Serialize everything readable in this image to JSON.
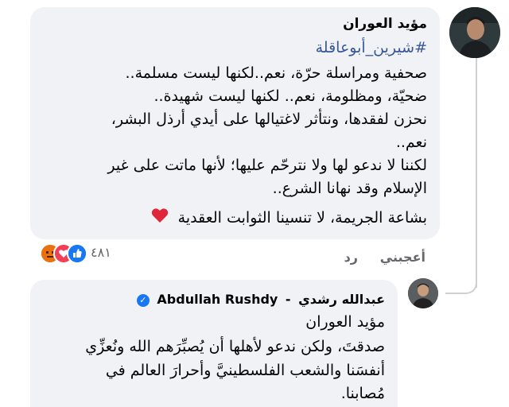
{
  "comment": {
    "author": "مؤيد العوران",
    "hashtag": "#شيرين_أبوعاقلة",
    "lines": [
      "صحفية ومراسلة حرّة، نعم..لكنها ليست مسلمة..",
      "ضحيّة، ومظلومة، نعم.. لكنها ليست شهيدة..",
      "نحزن لفقدها، ونتأثر لاغتيالها على أيدي أرذل البشر،",
      "نعم..",
      "لكننا لا ندعو لها ولا نترحّم عليها؛ لأنها ماتت على غير",
      "الإسلام وقد نهانا الشرع..",
      "بشاعة الجريمة، لا تنسينا الثوابت العقدية"
    ],
    "heart_emoji": "❤️",
    "reactions": {
      "icons": [
        "angry-icon",
        "love-icon",
        "like-icon"
      ],
      "count": "٤٨١"
    },
    "actions": {
      "like": "أعجبني",
      "reply": "رد"
    }
  },
  "reply": {
    "author_arabic": "عبدالله رشدي",
    "author_separator": "-",
    "author_latin": "Abdullah Rushdy",
    "mention": "مؤيد العوران",
    "lines": [
      "صدقتَ، ولكن ندعو لأهلها أن يُصبِّرَهم الله ونُعزِّي",
      "أنفسَنا والشعب الفلسطينيَّ وأحرارَ العالم في",
      "مُصابنا."
    ]
  },
  "colors": {
    "bubble": "#f0f2f5",
    "hashtag": "#385898",
    "secondary_text": "#65676b",
    "verified": "#1877f2"
  }
}
